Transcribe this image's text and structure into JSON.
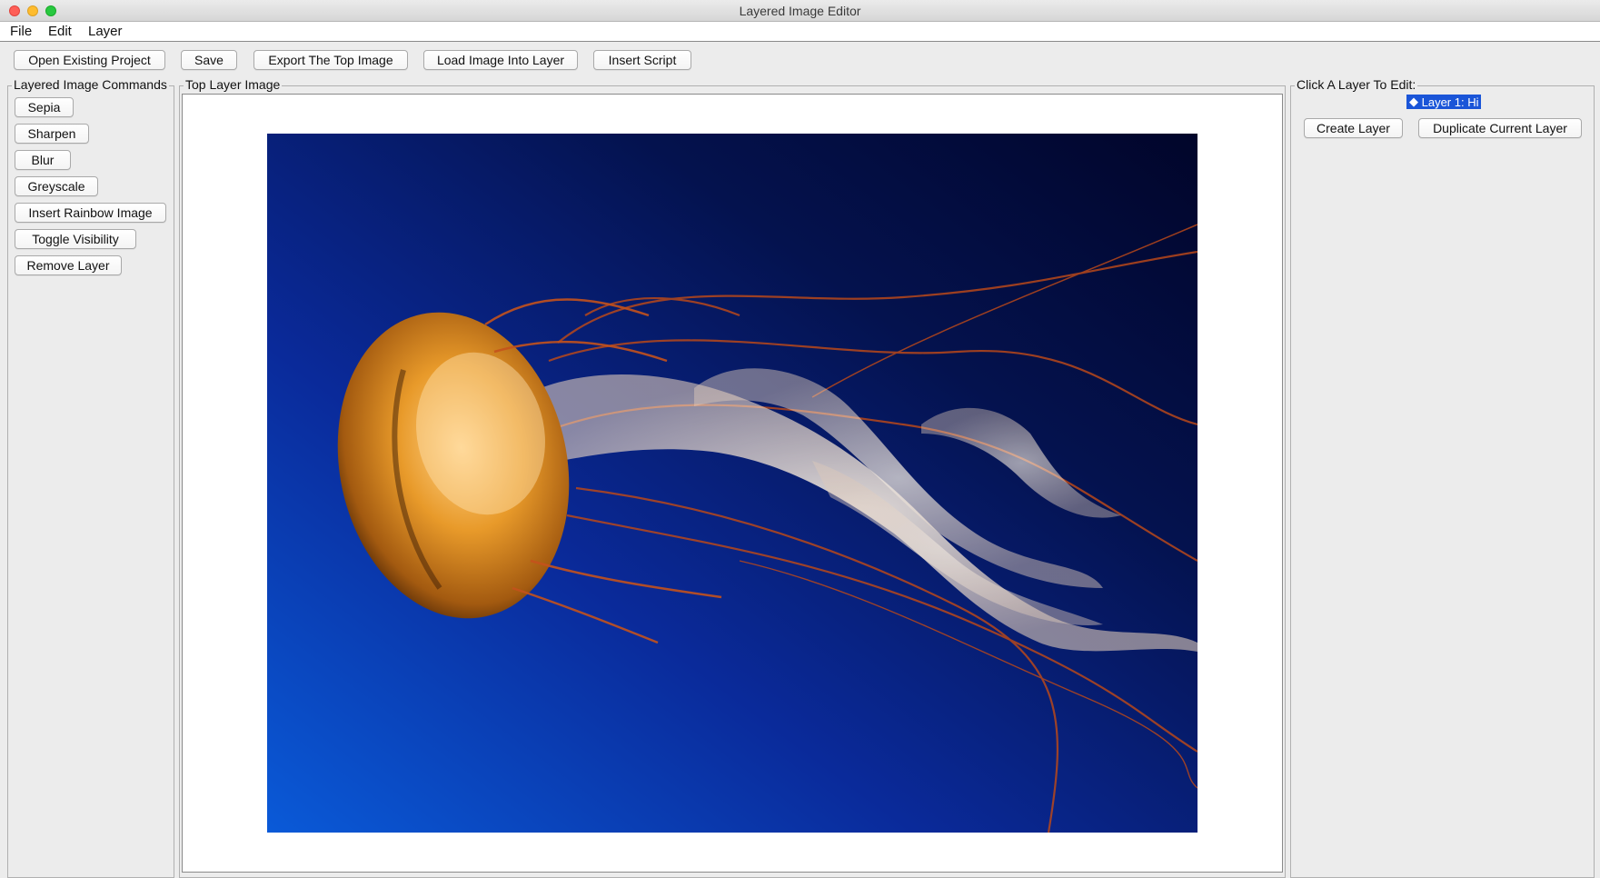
{
  "window": {
    "title": "Layered Image Editor"
  },
  "menu": [
    "File",
    "Edit",
    "Layer"
  ],
  "toolbar": {
    "open_label": "Open Existing Project",
    "save_label": "Save",
    "export_label": "Export The Top Image",
    "load_label": "Load Image Into Layer",
    "script_label": "Insert Script"
  },
  "commands": {
    "title": "Layered Image Commands",
    "items": [
      "Sepia",
      "Sharpen",
      "Blur",
      "Greyscale",
      "Insert Rainbow Image",
      "Toggle Visibility",
      "Remove Layer"
    ]
  },
  "canvas": {
    "title": "Top Layer Image",
    "image": "jellyfish-photo"
  },
  "layers": {
    "title": "Click A Layer To Edit:",
    "items": [
      "Layer 1: Hi"
    ],
    "selected_color": "#1a55d8",
    "create_label": "Create Layer",
    "duplicate_label": "Duplicate Current Layer"
  }
}
